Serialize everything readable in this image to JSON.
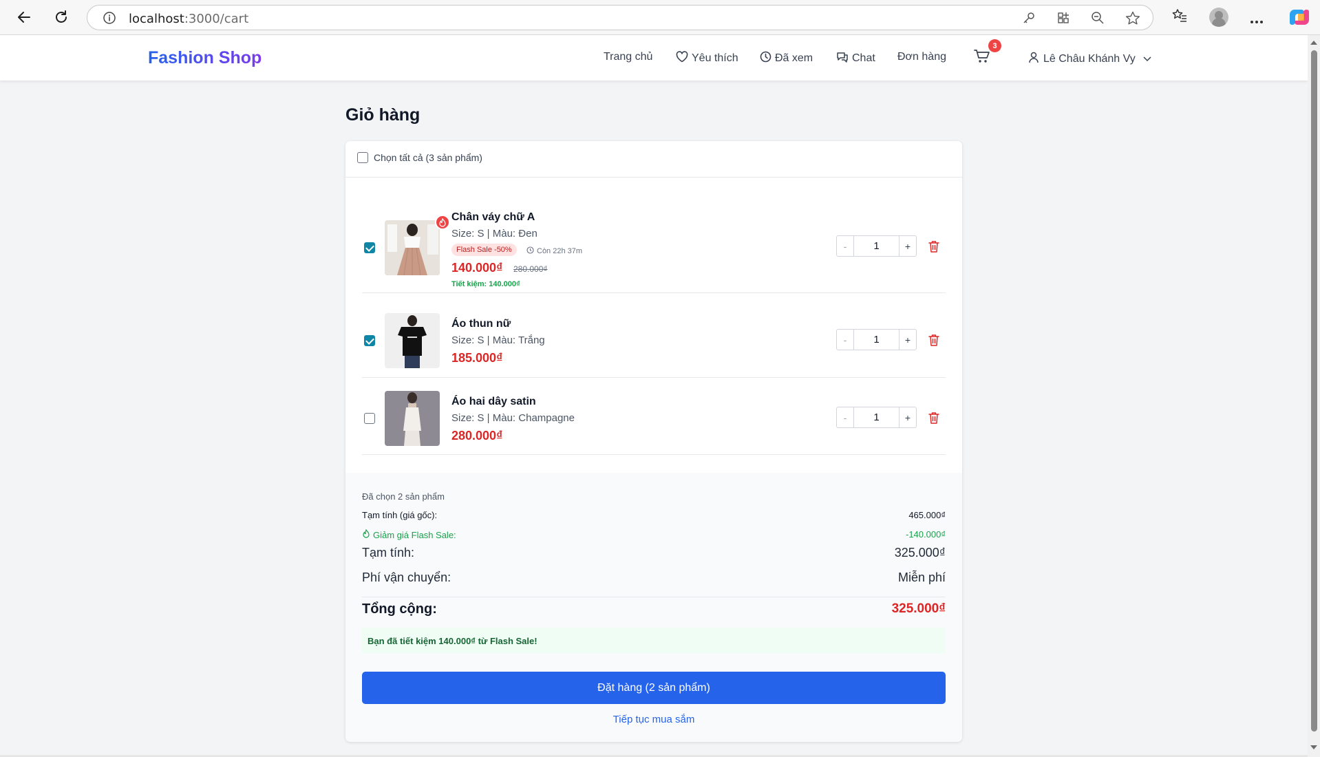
{
  "browser": {
    "url_host": "localhost",
    "url_path": ":3000/cart"
  },
  "header": {
    "logo": "Fashion Shop",
    "nav": {
      "home": "Trang chủ",
      "favorites": "Yêu thích",
      "viewed": "Đã xem",
      "chat": "Chat",
      "orders": "Đơn hàng"
    },
    "cart_count": "3",
    "user_name": "Lê Châu Khánh Vy"
  },
  "page": {
    "title": "Giỏ hàng",
    "select_all": "Chọn tất cả (3 sản phẩm)"
  },
  "items": [
    {
      "name": "Chân váy chữ A",
      "meta": "Size: S | Màu: Đen",
      "flash_badge": "Flash Sale -50%",
      "timer": "Còn 22h 37m",
      "price": "140.000₫",
      "old_price": "280.000₫",
      "saving": "Tiết kiệm: 140.000₫",
      "qty": "1",
      "selected": true
    },
    {
      "name": "Áo thun nữ",
      "meta": "Size: S | Màu: Trắng",
      "price": "185.000₫",
      "qty": "1",
      "selected": true
    },
    {
      "name": "Áo hai dây satin",
      "meta": "Size: S | Màu: Champagne",
      "price": "280.000₫",
      "qty": "1",
      "selected": false
    }
  ],
  "qty_controls": {
    "minus": "-",
    "plus": "+"
  },
  "summary": {
    "selected_count": "Đã chọn 2 sản phẩm",
    "subtotal_orig_label": "Tạm tính (giá gốc):",
    "subtotal_orig_value": "465.000₫",
    "flash_discount_label": "Giảm giá Flash Sale:",
    "flash_discount_value": "-140.000₫",
    "subtotal_label": "Tạm tính:",
    "subtotal_value": "325.000₫",
    "shipping_label": "Phí vận chuyển:",
    "shipping_value": "Miễn phí",
    "total_label": "Tổng cộng:",
    "total_value": "325.000₫",
    "savings_note": "Bạn đã tiết kiệm 140.000₫ từ Flash Sale!",
    "order_button": "Đặt hàng (2 sản phẩm)",
    "continue_link": "Tiếp tục mua sắm"
  },
  "colors": {
    "primary": "#2563eb",
    "price_red": "#dc2626",
    "success_green": "#16a34a",
    "checkbox_teal": "#0f86a6"
  },
  "icons": [
    "back-arrow-icon",
    "reload-icon",
    "info-icon",
    "key-icon",
    "apps-icon",
    "zoom-out-icon",
    "star-icon",
    "favorites-icon",
    "profile-icon",
    "more-icon",
    "copilot-icon",
    "heart-icon",
    "clock-icon",
    "chat-icon",
    "cart-icon",
    "user-icon",
    "chevron-down-icon",
    "fire-icon",
    "trash-icon"
  ]
}
